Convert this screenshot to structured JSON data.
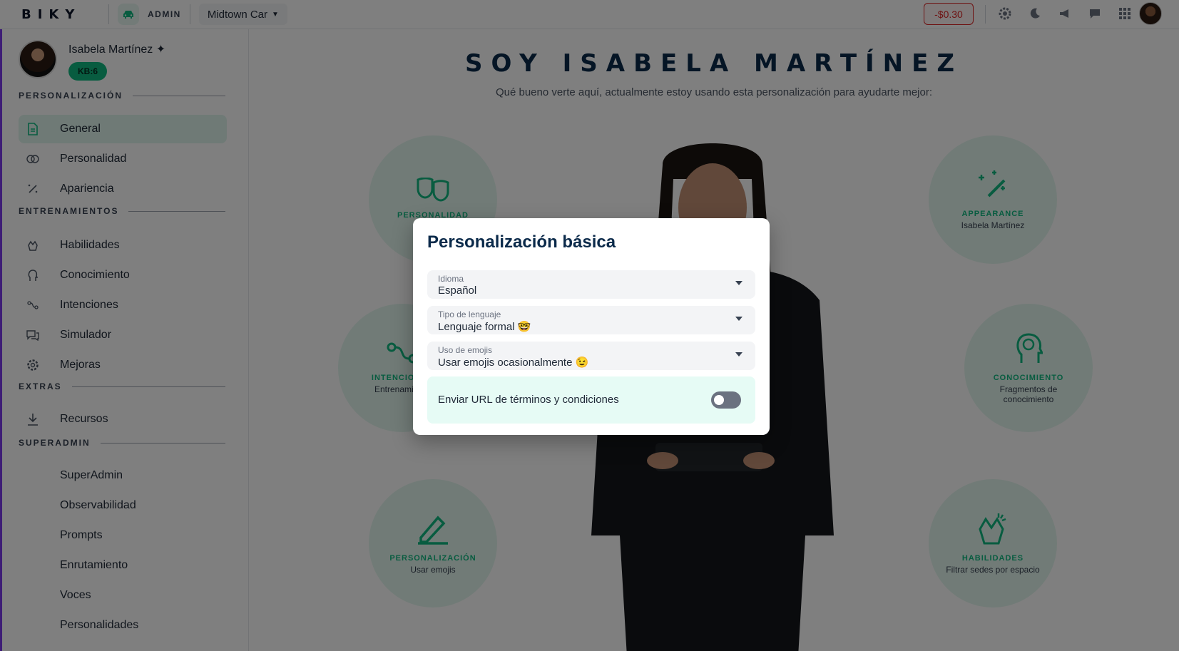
{
  "topbar": {
    "logo": "BIKY",
    "admin_label": "ADMIN",
    "company": "Midtown Car",
    "balance": "-$0.30",
    "icons": [
      "gear-icon",
      "moon-icon",
      "megaphone-icon",
      "chat-icon",
      "apps-grid-icon"
    ]
  },
  "sidebar": {
    "profile_name": "Isabela Martínez ✦",
    "kb_badge": "KB:6",
    "sections": {
      "personalizacion": "PERSONALIZACIÓN",
      "entrenamientos": "ENTRENAMIENTOS",
      "extras": "EXTRAS",
      "superadmin": "SUPERADMIN"
    },
    "items": [
      {
        "label": "General",
        "icon": "document-icon",
        "active": true
      },
      {
        "label": "Personalidad",
        "icon": "masks-icon"
      },
      {
        "label": "Apariencia",
        "icon": "sparkles-icon"
      },
      {
        "label": "Habilidades",
        "icon": "hands-clap-icon"
      },
      {
        "label": "Conocimiento",
        "icon": "head-icon"
      },
      {
        "label": "Intenciones",
        "icon": "route-icon"
      },
      {
        "label": "Simulador",
        "icon": "chat-bubbles-icon"
      },
      {
        "label": "Mejoras",
        "icon": "gear-icon"
      },
      {
        "label": "Recursos",
        "icon": "download-icon"
      },
      {
        "label": "SuperAdmin"
      },
      {
        "label": "Observabilidad"
      },
      {
        "label": "Prompts"
      },
      {
        "label": "Enrutamiento"
      },
      {
        "label": "Voces"
      },
      {
        "label": "Personalidades"
      }
    ]
  },
  "main": {
    "title": "SOY ISABELA MARTÍNEZ",
    "subtitle": "Qué bueno verte aquí, actualmente estoy usando esta personalización para ayudarte mejor:",
    "cards": {
      "personalidad": {
        "title": "PERSONALIDAD",
        "sub": ""
      },
      "appearance": {
        "title": "APPEARANCE",
        "sub": "Isabela Martínez"
      },
      "intenciones": {
        "title": "INTENCIONES",
        "sub": "Entrenamiento"
      },
      "conocimiento": {
        "title": "CONOCIMIENTO",
        "sub": "Fragmentos de conocimiento"
      },
      "personalizacion": {
        "title": "PERSONALIZACIÓN",
        "sub": "Usar emojis"
      },
      "habilidades": {
        "title": "HABILIDADES",
        "sub": "Filtrar sedes por espacio"
      }
    }
  },
  "modal": {
    "title": "Personalización básica",
    "fields": [
      {
        "label": "Idioma",
        "value": "Español"
      },
      {
        "label": "Tipo de lenguaje",
        "value": "Lenguaje formal 🤓"
      },
      {
        "label": "Uso de emojis",
        "value": "Usar emojis ocasionalmente 😉"
      }
    ],
    "toggle": {
      "label": "Enviar URL de términos y condiciones",
      "on": false
    }
  },
  "colors": {
    "accent": "#10b981",
    "danger": "#dc2626",
    "title": "#0b2a4a",
    "active_bg": "#dff5ec"
  }
}
